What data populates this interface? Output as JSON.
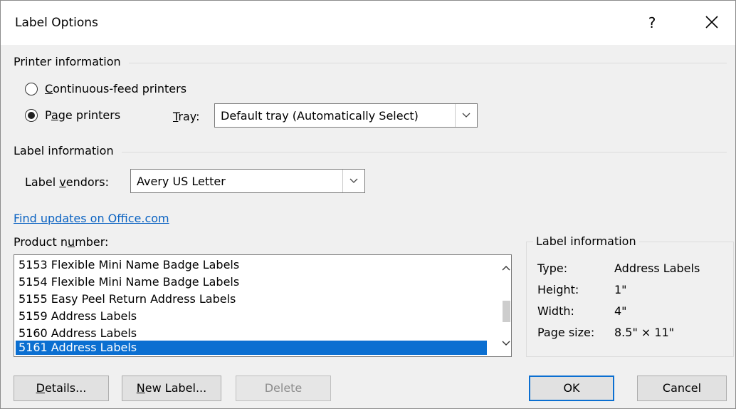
{
  "dialog": {
    "title": "Label Options",
    "help_label": "?",
    "close_icon": "close-icon"
  },
  "printer_info": {
    "group_label": "Printer information",
    "continuous_feed": {
      "access_key": "C",
      "rest": "ontinuous-feed printers",
      "selected": false
    },
    "page_printers": {
      "prefix": "P",
      "access_key": "a",
      "rest": "ge printers",
      "selected": true
    },
    "tray": {
      "access_key": "T",
      "rest": "ray:",
      "value": "Default tray (Automatically Select)"
    }
  },
  "label_info": {
    "group_label": "Label information",
    "vendors": {
      "prefix": "Label ",
      "access_key": "v",
      "rest": "endors:",
      "value": "Avery US Letter"
    }
  },
  "link": {
    "text": "Find updates on Office.com"
  },
  "product_number": {
    "prefix": "Product n",
    "access_key": "u",
    "rest": "mber:",
    "items": [
      "5153 Flexible Mini Name Badge Labels",
      "5154 Flexible Mini Name Badge Labels",
      "5155 Easy Peel Return Address Labels",
      "5159 Address Labels",
      "5160 Address Labels",
      "5161 Address Labels"
    ],
    "selected_index": 5
  },
  "label_details": {
    "title": "Label information",
    "rows": [
      {
        "key": "Type:",
        "value": "Address Labels"
      },
      {
        "key": "Height:",
        "value": "1\""
      },
      {
        "key": "Width:",
        "value": "4\""
      },
      {
        "key": "Page size:",
        "value": "8.5\" × 11\""
      }
    ]
  },
  "buttons": {
    "details": {
      "access_key": "D",
      "rest": "etails..."
    },
    "new_label": {
      "access_key": "N",
      "rest": "ew Label..."
    },
    "delete": {
      "label": "Delete",
      "disabled": true
    },
    "ok": {
      "label": "OK"
    },
    "cancel": {
      "label": "Cancel"
    }
  },
  "colors": {
    "accent": "#0b6fd1",
    "link": "#0b63c2"
  }
}
